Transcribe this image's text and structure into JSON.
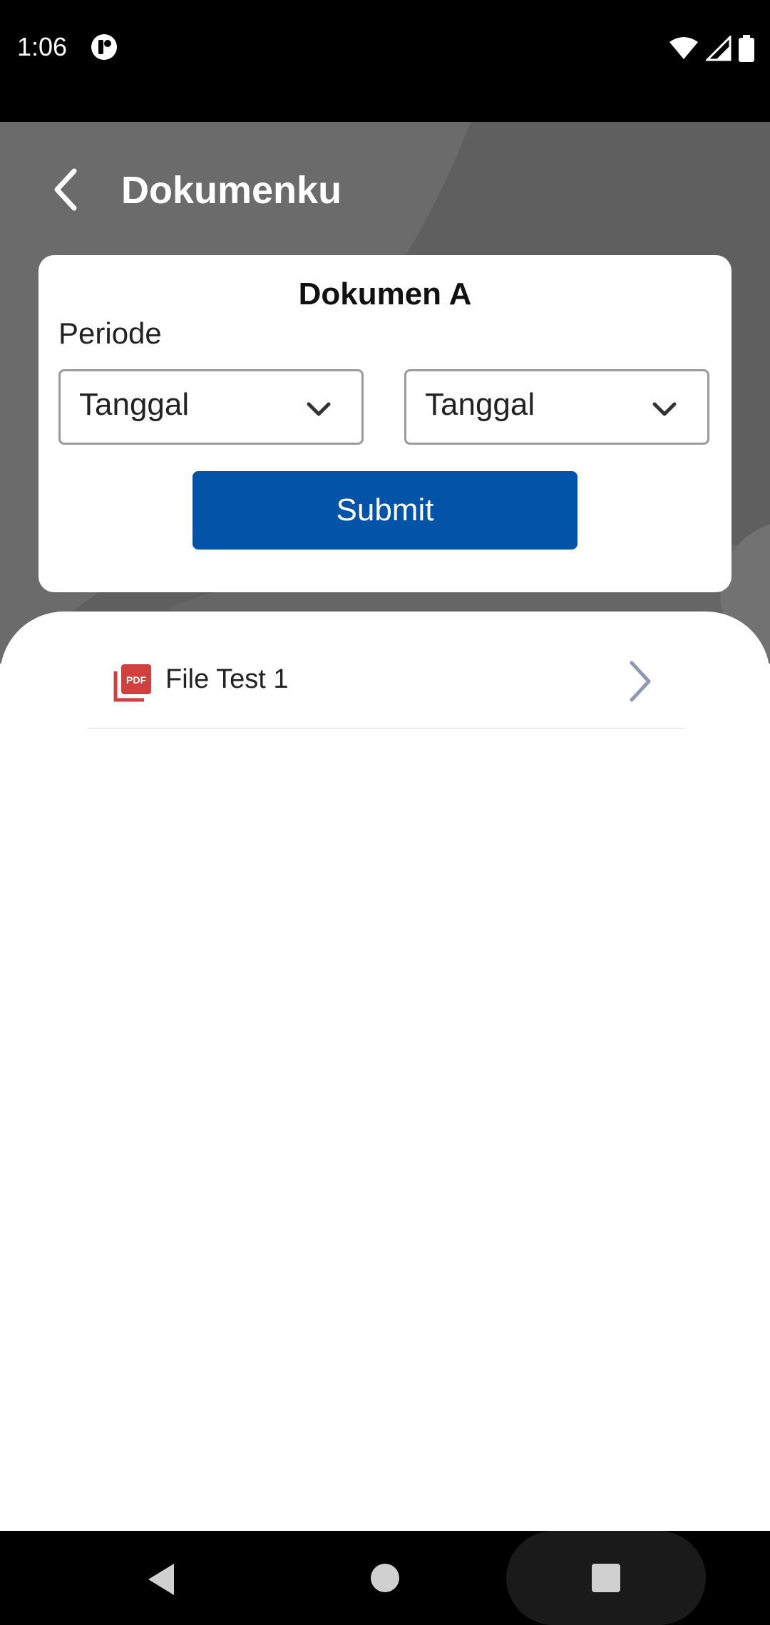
{
  "status_bar": {
    "time": "1:06",
    "notification_icon": "notification-app-icon",
    "icons": [
      "wifi-icon",
      "signal-icon",
      "battery-icon"
    ]
  },
  "header": {
    "title": "Dokumenku",
    "back_icon": "chevron-left-icon",
    "background_color": "#6b6b6b"
  },
  "filter_card": {
    "title": "Dokumen A",
    "period_label": "Periode",
    "start_date": {
      "value": "Tanggal",
      "icon": "chevron-down-icon"
    },
    "end_date": {
      "value": "Tanggal",
      "icon": "chevron-down-icon"
    },
    "submit_label": "Submit",
    "accent_color": "#0354a8"
  },
  "documents": [
    {
      "name": "File Test 1",
      "icon": "pdf-icon",
      "action_icon": "chevron-right-icon"
    }
  ],
  "nav_bar": {
    "buttons": [
      "back-triangle-icon",
      "home-circle-icon",
      "recents-square-icon"
    ]
  }
}
